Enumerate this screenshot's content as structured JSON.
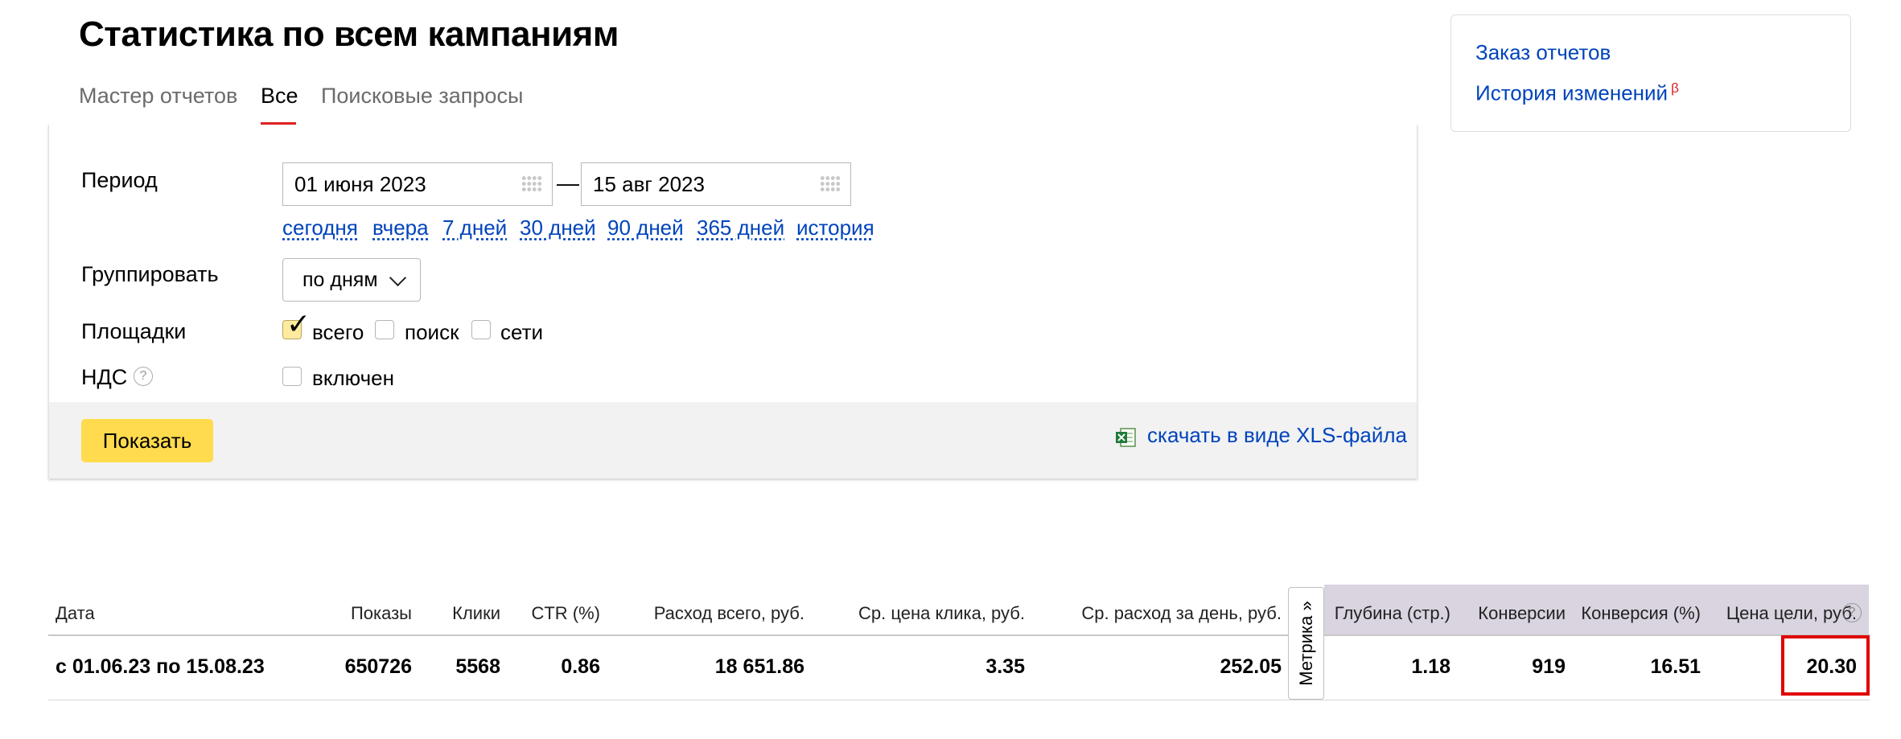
{
  "title": "Статистика по всем кампаниям",
  "tabs": [
    {
      "label": "Мастер отчетов"
    },
    {
      "label": "Все",
      "active": true
    },
    {
      "label": "Поисковые запросы"
    }
  ],
  "sidebar": {
    "links": [
      "Заказ отчетов",
      "История изменений"
    ],
    "beta_mark": "β"
  },
  "filters": {
    "period_label": "Период",
    "date_from": "01 июня 2023",
    "date_separator": "—",
    "date_to": "15 авг 2023",
    "quick_ranges": [
      "сегодня",
      "вчера",
      "7 дней",
      "30 дней",
      "90 дней",
      "365 дней",
      "история"
    ],
    "group_label": "Группировать",
    "group_value": "по дням",
    "platforms_label": "Площадки",
    "platforms": [
      {
        "label": "всего",
        "checked": true
      },
      {
        "label": "поиск",
        "checked": false
      },
      {
        "label": "сети",
        "checked": false
      }
    ],
    "vat_label": "НДС",
    "vat_help": "?",
    "vat_option": {
      "label": "включен",
      "checked": false
    }
  },
  "actions": {
    "show_button": "Показать",
    "download_link": "скачать в виде XLS-файла"
  },
  "table": {
    "columns": [
      "Дата",
      "Показы",
      "Клики",
      "CTR (%)",
      "Расход всего, руб.",
      "Ср. цена клика, руб.",
      "Ср. расход за день, руб.",
      "Глубина (стр.)",
      "Конверсии",
      "Конверсия (%)",
      "Цена цели, руб."
    ],
    "metrika_tab": "Метрика »",
    "help": "?",
    "row": [
      "с 01.06.23 по 15.08.23",
      "650726",
      "5568",
      "0.86",
      "18 651.86",
      "3.35",
      "252.05",
      "1.18",
      "919",
      "16.51",
      "20.30"
    ]
  },
  "colors": {
    "accent_red": "#e02020",
    "link_blue": "#0044bb",
    "button_yellow": "#ffdb4d",
    "metrika_header": "#d9d4e0",
    "highlight_red": "#e00000"
  }
}
